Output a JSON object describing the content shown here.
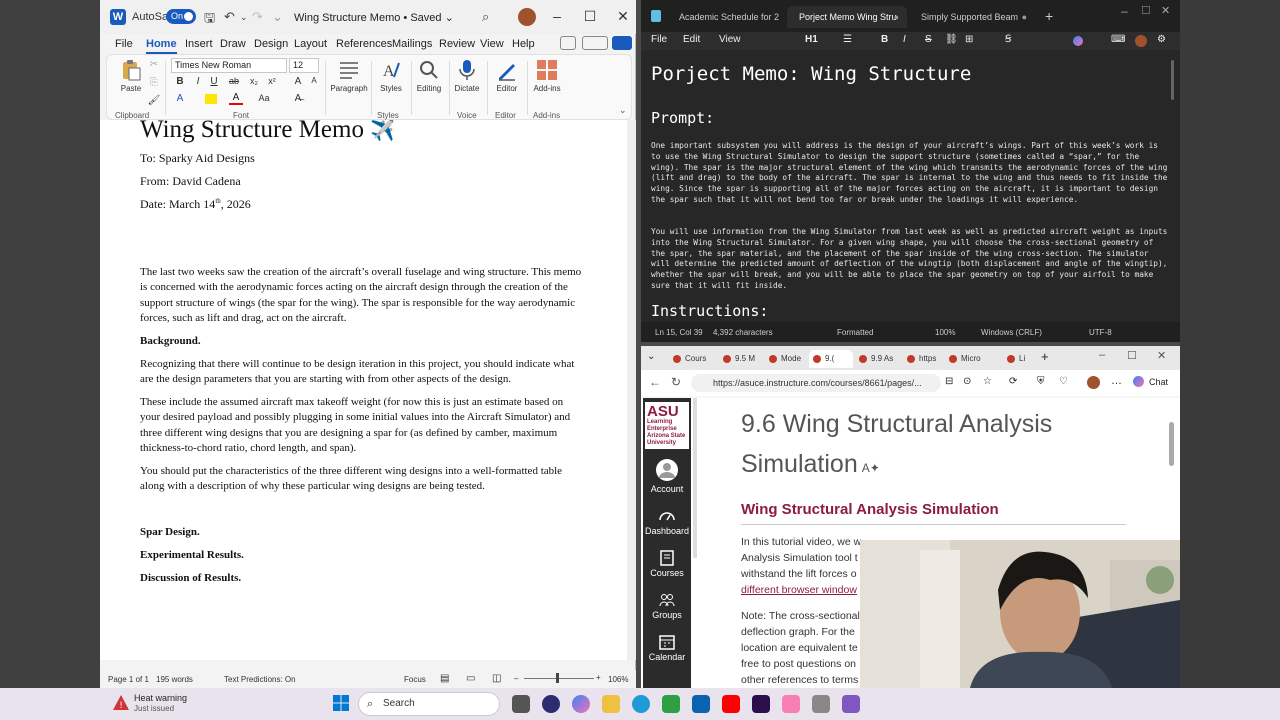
{
  "word": {
    "autosave_label": "AutoSave",
    "autosave_state": "On",
    "doc_title": "Wing Structure Memo • Saved ⌄",
    "menu": [
      "File",
      "Home",
      "Insert",
      "Draw",
      "Design",
      "Layout",
      "References",
      "Mailings",
      "Review",
      "View",
      "Help"
    ],
    "active_menu": "Home",
    "ribbon": {
      "paste": "Paste",
      "clipboard": "Clipboard",
      "font_name": "Times New Roman",
      "font_size": "12",
      "font_group": "Font",
      "paragraph": "Paragraph",
      "styles": "Styles",
      "editing": "Editing",
      "dictate": "Dictate",
      "voice": "Voice",
      "editor": "Editor",
      "editor_group": "Editor",
      "addins": "Add-ins",
      "addins_group": "Add-ins",
      "bold": "B",
      "italic": "I",
      "underline": "U",
      "strike": "ab",
      "sub": "x₂",
      "sup": "x²"
    },
    "document": {
      "title": "Wing Structure Memo",
      "title_emoji": "✈️",
      "to": "To: Sparky Aid Designs",
      "from": "From: David Cadena",
      "date_pre": "Date: March 14",
      "date_sup": "th",
      "date_post": ", 2026",
      "intro": "The last two weeks saw the creation of the aircraft’s overall fuselage and wing structure. This memo is concerned with the aerodynamic forces acting on the aircraft design through the creation of the support structure of wings (the spar for the wing). The spar is responsible for the way aerodynamic forces, such as lift and drag, act on the aircraft.",
      "background_heading": "Background.",
      "bg_p1": "Recognizing that there will continue to be design iteration in this project, you should indicate what are the design parameters that you are starting with from other aspects of the design.",
      "bg_p2": "These include the assumed aircraft max takeoff weight (for now this is just an estimate based on your desired payload and possibly plugging in some initial values into the Aircraft Simulator) and three different wing designs that you are designing a spar for (as defined by camber, maximum thickness-to-chord ratio, chord length, and span).",
      "bg_p3": "You should put the characteristics of the three different wing designs into a well-formatted table along with a description of why these particular wing designs are being tested.",
      "spar_heading": "Spar Design.",
      "experimental_heading": "Experimental Results.",
      "discussion_heading": "Discussion of Results."
    },
    "status": {
      "page": "Page 1 of 1",
      "words": "195 words",
      "predictions": "Text Predictions: On",
      "focus": "Focus",
      "zoom": "106%"
    }
  },
  "notepad": {
    "tabs": [
      {
        "label": "Academic Schedule for 2",
        "active": false
      },
      {
        "label": "Porject Memo Wing Stru",
        "active": true
      },
      {
        "label": "Simply Supported Beam",
        "active": false
      }
    ],
    "menu": [
      "File",
      "Edit",
      "View"
    ],
    "heading_level": "H1",
    "heading": "Porject Memo: Wing Structure",
    "prompt_heading": "Prompt:",
    "prompt_p1": "One important subsystem you will address is the design of your aircraft’s wings. Part of this week’s work is to use the Wing Structural Simulator to design the support structure (sometimes called a “spar,” for the wing). The spar is the major structural element of the wing which transmits the aerodynamic forces of the wing (lift and drag) to the body of the aircraft. The spar is internal to the wing and thus needs to fit inside the wing. Since the spar is supporting all of the major forces acting on the aircraft, it is important to design the spar such that it will not bend too far or break under the loadings it will experience.",
    "prompt_p2": "You will use information from the Wing Simulator from last week as well as predicted aircraft weight as inputs into the Wing Structural Simulator. For a given wing shape, you will choose the cross-sectional geometry of the spar, the spar material, and the placement of the spar inside of the wing cross-section. The simulator will determine the predicted amount of deflection of the wingtip (both displacement and angle of the wingtip), whether the spar will break, and you will be able to place the spar geometry on top of your airfoil to make sure that it will fit inside.",
    "instructions_heading": "Instructions:",
    "status": {
      "position": "Ln 15, Col 39",
      "chars": "4,392 characters",
      "format": "Formatted",
      "zoom": "100%",
      "eol": "Windows (CRLF)",
      "encoding": "UTF-8"
    }
  },
  "edge": {
    "tabs": [
      "Cours",
      "9.5 M",
      "Mode",
      "9.(",
      "9.9 As",
      "https",
      "Micro",
      "Li"
    ],
    "url": "https://asuce.instructure.com/courses/8661/pages/...",
    "chat": "Chat",
    "logo_big": "ASU",
    "logo_small": "Learning Enterprise Arizona State University",
    "nav": [
      "Account",
      "Dashboard",
      "Courses",
      "Groups",
      "Calendar"
    ],
    "page_title": "9.6 Wing Structural Analysis Simulation",
    "section_heading": "Wing Structural Analysis Simulation",
    "p1_line1": "In this tutorial video, we w",
    "p1_line2": "Analysis Simulation tool t",
    "p1_line3": "withstand the lift forces o",
    "p1_link": "different browser window",
    "p2_line1": "Note: The cross-sectional",
    "p2_line2": "deflection graph. For the",
    "p2_line3": "location are equivalent te",
    "p2_line4": "free to post questions on",
    "p2_line5": "other references to terms"
  },
  "taskbar": {
    "heat_title": "Heat warning",
    "heat_sub": "Just issued",
    "search": "Search"
  },
  "colors": {
    "word_blue": "#185abd",
    "asu_maroon": "#8c1d40",
    "notepad_bg": "#272727"
  }
}
